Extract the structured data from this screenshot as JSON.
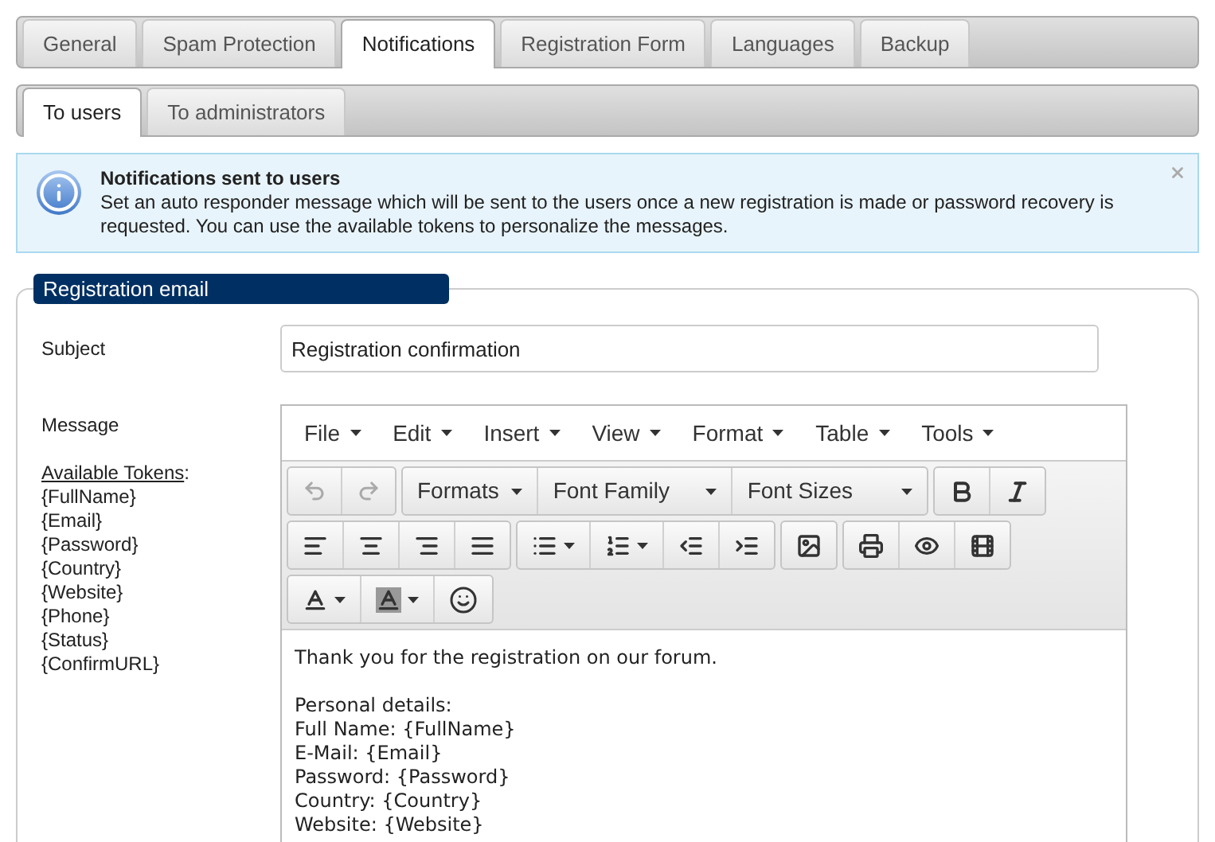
{
  "tabs": [
    {
      "label": "General",
      "selected": false
    },
    {
      "label": "Spam Protection",
      "selected": false
    },
    {
      "label": "Notifications",
      "selected": true
    },
    {
      "label": "Registration Form",
      "selected": false
    },
    {
      "label": "Languages",
      "selected": false
    },
    {
      "label": "Backup",
      "selected": false
    }
  ],
  "subtabs": [
    {
      "label": "To users",
      "selected": true
    },
    {
      "label": "To administrators",
      "selected": false
    }
  ],
  "notice": {
    "title": "Notifications sent to users",
    "text": "Set an auto responder message which will be sent to the users once a new registration is made or password recovery is requested. You can use the available tokens to personalize the messages."
  },
  "section": {
    "legend": "Registration email",
    "subject": {
      "label": "Subject",
      "value": "Registration confirmation"
    },
    "message": {
      "label": "Message",
      "tokens_heading": "Available Tokens",
      "tokens_suffix": ":",
      "tokens": [
        "{FullName}",
        "{Email}",
        "{Password}",
        "{Country}",
        "{Website}",
        "{Phone}",
        "{Status}",
        "{ConfirmURL}"
      ]
    },
    "editor": {
      "menu": [
        "File",
        "Edit",
        "Insert",
        "View",
        "Format",
        "Table",
        "Tools"
      ],
      "history": {
        "undo_disabled": true,
        "redo_disabled": true
      },
      "dropdowns": [
        "Formats",
        "Font Family",
        "Font Sizes"
      ],
      "content": [
        [
          "Thank you for the registration on our forum."
        ],
        [
          "Personal details:",
          "Full Name: {FullName}",
          "E-Mail: {Email}",
          "Password: {Password}",
          "Country: {Country}",
          "Website: {Website}"
        ]
      ]
    }
  }
}
